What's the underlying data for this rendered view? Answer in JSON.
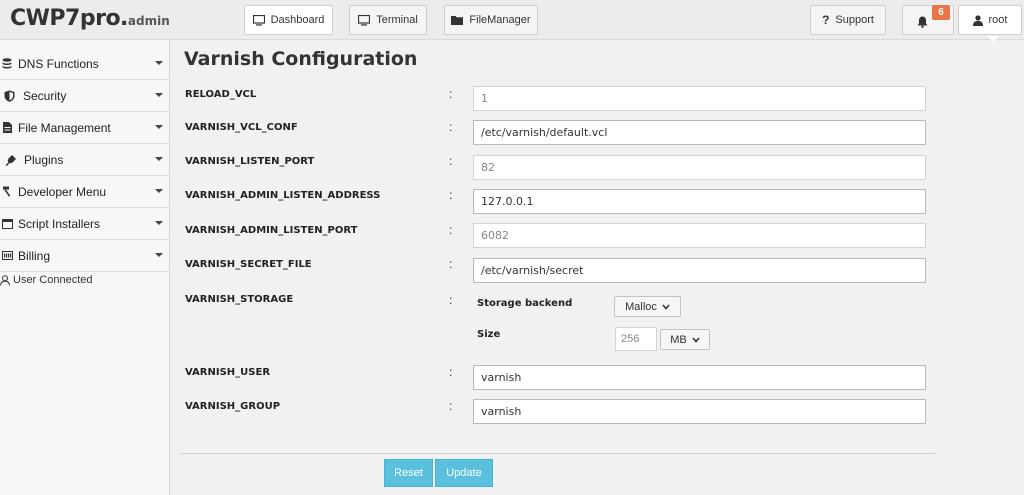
{
  "header": {
    "logo_main": "CWP7pro.",
    "logo_sub": "admin",
    "nav": [
      {
        "label": "Dashboard",
        "icon": "monitor-icon"
      },
      {
        "label": "Terminal",
        "icon": "monitor-icon"
      },
      {
        "label": "FileManager",
        "icon": "folder-icon"
      }
    ],
    "support_label": "Support",
    "notification_count": "6",
    "user_label": "root"
  },
  "sidebar": {
    "items": [
      {
        "label": "DNS Functions",
        "icon": "database-icon"
      },
      {
        "label": "Security",
        "icon": "shield-icon"
      },
      {
        "label": "File Management",
        "icon": "file-icon"
      },
      {
        "label": "Plugins",
        "icon": "plug-icon"
      },
      {
        "label": "Developer Menu",
        "icon": "hammer-icon"
      },
      {
        "label": "Script Installers",
        "icon": "window-icon"
      },
      {
        "label": "Billing",
        "icon": "billing-icon"
      }
    ],
    "user_connected": "User Connected"
  },
  "main": {
    "title": "Varnish Configuration",
    "fields": [
      {
        "label": "RELOAD_VCL",
        "value": "1"
      },
      {
        "label": "VARNISH_VCL_CONF",
        "value": "/etc/varnish/default.vcl"
      },
      {
        "label": "VARNISH_LISTEN_PORT",
        "value": "82"
      },
      {
        "label": "VARNISH_ADMIN_LISTEN_ADDRESS",
        "value": "127.0.0.1"
      },
      {
        "label": "VARNISH_ADMIN_LISTEN_PORT",
        "value": "6082"
      },
      {
        "label": "VARNISH_SECRET_FILE",
        "value": "/etc/varnish/secret"
      },
      {
        "label": "VARNISH_STORAGE",
        "value": ""
      },
      {
        "label": "VARNISH_USER",
        "value": "varnish"
      },
      {
        "label": "VARNISH_GROUP",
        "value": "varnish"
      }
    ],
    "colon": ":",
    "storage": {
      "backend_label": "Storage backend",
      "backend_value": "Malloc",
      "size_label": "Size",
      "size_value": "256",
      "unit_value": "MB"
    },
    "buttons": {
      "reset": "Reset",
      "update": "Update"
    }
  },
  "colors": {
    "button_bg": "#5bc0de",
    "badge_bg": "#e8754a"
  }
}
